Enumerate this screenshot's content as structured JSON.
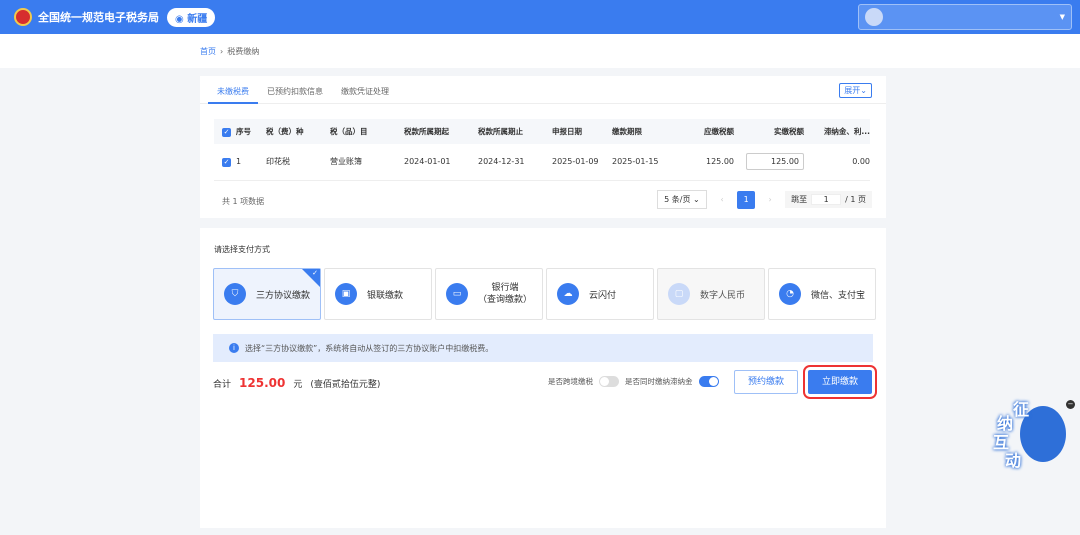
{
  "header": {
    "title": "全国统一规范电子税务局",
    "region": "新疆"
  },
  "breadcrumb": [
    "首页",
    "税费缴纳"
  ],
  "tabs": [
    "未缴税费",
    "已预约扣款信息",
    "缴款凭证处理"
  ],
  "expand": "展开",
  "table": {
    "headers": [
      "序号",
      "税（费）种",
      "税（品）目",
      "税款所属期起",
      "税款所属期止",
      "申报日期",
      "缴款期限",
      "应缴税额",
      "实缴税额",
      "滞纳金、利..."
    ],
    "rows": [
      [
        "1",
        "印花税",
        "营业账簿",
        "2024-01-01",
        "2024-12-31",
        "2025-01-09",
        "2025-01-15",
        "125.00",
        "125.00",
        "0.00"
      ]
    ]
  },
  "pagination": {
    "total": "共 1 项数据",
    "page_size": "5 条/页",
    "current": "1",
    "jump_label": "跳至",
    "jump_value": "1",
    "pages": "/ 1 页"
  },
  "payment": {
    "label": "请选择支付方式",
    "methods": [
      {
        "name": "三方协议缴款",
        "selected": true
      },
      {
        "name": "银联缴款"
      },
      {
        "name": "银行端",
        "sub": "（查询缴款）"
      },
      {
        "name": "云闪付"
      },
      {
        "name": "数字人民币",
        "disabled": true
      },
      {
        "name": "微信、支付宝"
      }
    ],
    "info": "选择“三方协议缴款”，系统将自动从签订的三方协议账户中扣缴税费。",
    "total_label": "合计",
    "total": "125.00",
    "unit": "元",
    "total_text": "(壹佰贰拾伍元整)",
    "cross_region": "是否跨境缴税",
    "cross_state": "否",
    "late_fee": "是否同时缴纳滞纳金",
    "late_state": "是",
    "reserve": "预约缴款",
    "pay_now": "立即缴款"
  },
  "mascot": [
    "征",
    "纳",
    "互",
    "动"
  ]
}
